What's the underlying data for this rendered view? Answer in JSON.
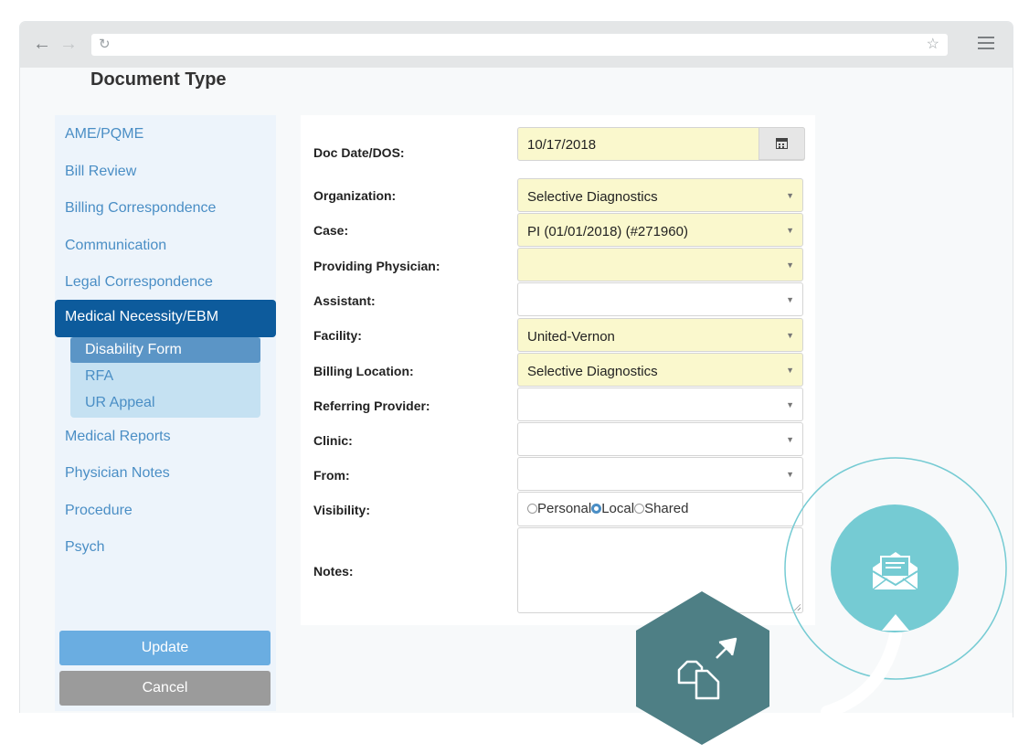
{
  "page": {
    "title": "Document Type"
  },
  "sidebar": {
    "items": [
      {
        "label": "AME/PQME"
      },
      {
        "label": "Bill Review"
      },
      {
        "label": "Billing Correspondence"
      },
      {
        "label": "Communication"
      },
      {
        "label": "Legal Correspondence"
      },
      {
        "label": "Medical Necessity/EBM"
      },
      {
        "label": "Medical Reports"
      },
      {
        "label": "Physician Notes"
      },
      {
        "label": "Procedure"
      },
      {
        "label": "Psych"
      }
    ],
    "subitems": [
      {
        "label": "Disability Form"
      },
      {
        "label": "RFA"
      },
      {
        "label": "UR Appeal"
      }
    ],
    "update_label": "Update",
    "cancel_label": "Cancel"
  },
  "form": {
    "doc_date": {
      "label": "Doc Date/DOS:",
      "value": "10/17/2018"
    },
    "organization": {
      "label": "Organization:",
      "value": "Selective Diagnostics"
    },
    "case": {
      "label": "Case:",
      "value": "PI (01/01/2018) (#271960)"
    },
    "providing_physician": {
      "label": "Providing Physician:",
      "value": ""
    },
    "assistant": {
      "label": "Assistant:",
      "value": ""
    },
    "facility": {
      "label": "Facility:",
      "value": "United-Vernon"
    },
    "billing_location": {
      "label": "Billing Location:",
      "value": "Selective Diagnostics"
    },
    "referring_provider": {
      "label": "Referring Provider:",
      "value": ""
    },
    "clinic": {
      "label": "Clinic:",
      "value": ""
    },
    "from": {
      "label": "From:",
      "value": ""
    },
    "visibility": {
      "label": "Visibility:",
      "options": [
        "Personal",
        "Local",
        "Shared"
      ],
      "selected": "Local"
    },
    "notes": {
      "label": "Notes:",
      "value": ""
    }
  },
  "colors": {
    "accent": "#0d5b9c",
    "link": "#4a8ec5",
    "highlight_field": "#faf8cd",
    "teal": "#75cbd3",
    "hexagon": "#4e7f85"
  },
  "icons": {
    "envelope": "open-envelope-icon",
    "documents": "copy-documents-icon",
    "calendar": "calendar-icon"
  }
}
